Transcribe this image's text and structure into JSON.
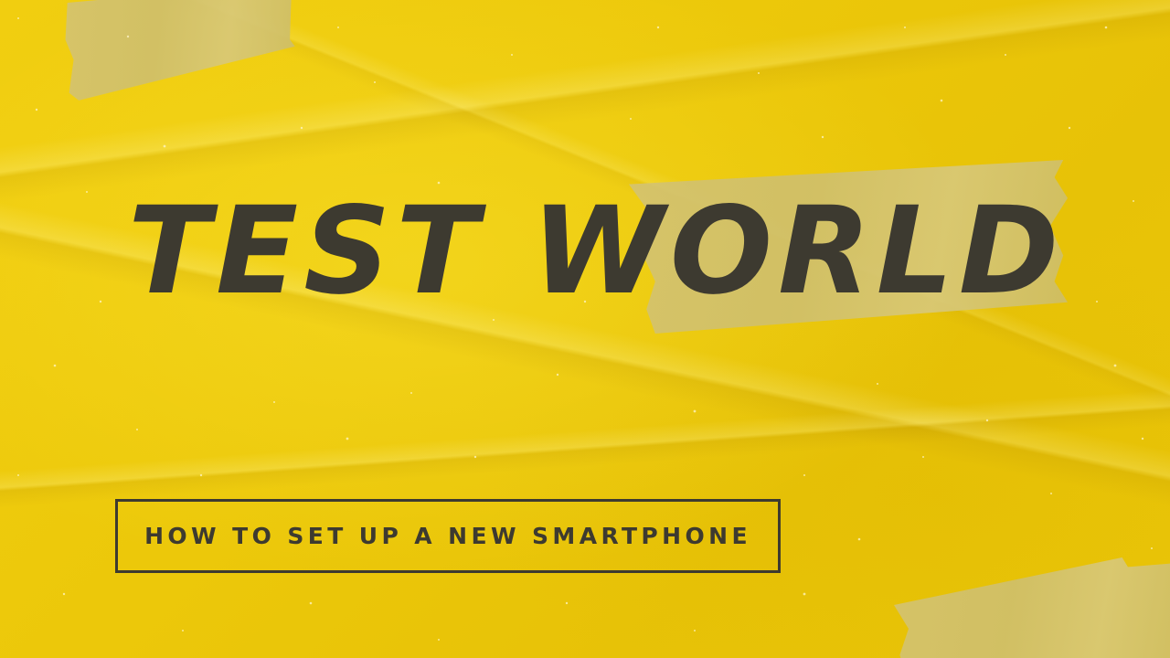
{
  "poster": {
    "title": "TEST WORLD",
    "subtitle": "HOW TO SET UP A NEW SMARTPHONE"
  },
  "colors": {
    "background": "#ecc80a",
    "text": "#3d3a30",
    "tape": "#d2c26e"
  }
}
